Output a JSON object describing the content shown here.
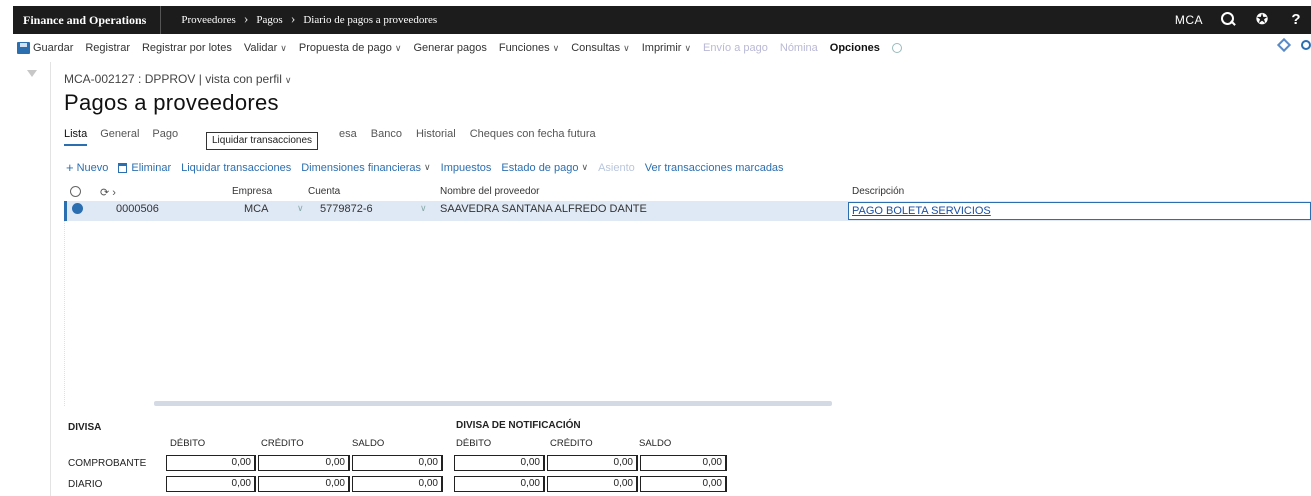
{
  "app": {
    "name": "Finance and Operations",
    "breadcrumbs": [
      "Proveedores",
      "Pagos",
      "Diario de pagos a proveedores"
    ],
    "company": "MCA"
  },
  "actions": {
    "guardar": "Guardar",
    "registrar": "Registrar",
    "registrar_lotes": "Registrar por lotes",
    "validar": "Validar",
    "propuesta_pago": "Propuesta de pago",
    "generar_pagos": "Generar pagos",
    "funciones": "Funciones",
    "consultas": "Consultas",
    "imprimir": "Imprimir",
    "envio_pago": "Envío a pago",
    "nomina": "Nómina",
    "opciones": "Opciones"
  },
  "record": {
    "info": "MCA-002127 : DPPROV",
    "view": "vista con perfil"
  },
  "page_title": "Pagos a proveedores",
  "tabs": [
    "Lista",
    "General",
    "Pago"
  ],
  "tabs_after": [
    "esa",
    "Banco",
    "Historial",
    "Cheques con fecha futura"
  ],
  "tooltip": "Liquidar transacciones",
  "grid_toolbar": {
    "nuevo": "Nuevo",
    "eliminar": "Eliminar",
    "liquidar": "Liquidar transacciones",
    "dimensiones": "Dimensiones financieras",
    "impuestos": "Impuestos",
    "estado_pago": "Estado de pago",
    "asiento": "Asiento",
    "ver_marcadas": "Ver transacciones marcadas"
  },
  "grid": {
    "columns": {
      "empresa": "Empresa",
      "cuenta": "Cuenta",
      "nombre": "Nombre del proveedor",
      "descripcion": "Descripción"
    },
    "row": {
      "voucher": "0000506",
      "empresa": "MCA",
      "cuenta": "5779872-6",
      "nombre": "SAAVEDRA SANTANA ALFREDO DANTE",
      "descripcion": "PAGO BOLETA SERVICIOS"
    }
  },
  "totals": {
    "divisa_label": "DIVISA",
    "divisa_notif_label": "DIVISA DE NOTIFICACIÓN",
    "debito": "DÉBITO",
    "credito": "CRÉDITO",
    "saldo": "SALDO",
    "comprobante_label": "COMPROBANTE",
    "diario_label": "DIARIO",
    "comprobante": [
      "0,00",
      "0,00",
      "0,00",
      "0,00",
      "0,00",
      "0,00"
    ],
    "diario": [
      "0,00",
      "0,00",
      "0,00",
      "0,00",
      "0,00",
      "0,00"
    ]
  },
  "colors": {
    "accent": "#2c6fb0",
    "topbar": "#1c1c1c",
    "selected_row": "#dfe9f6"
  }
}
